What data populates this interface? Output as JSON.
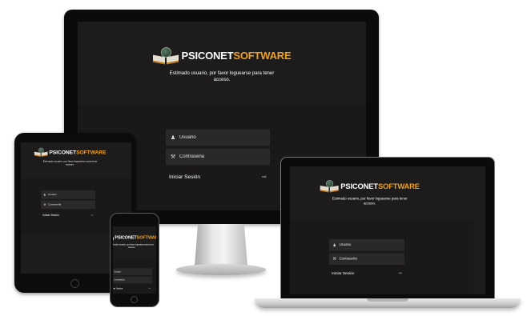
{
  "brand": {
    "name_part1": "PSICONET",
    "name_part2": "SOFTWARE",
    "accent_color": "#f0a21c",
    "logo_icon": "globe-book-icon"
  },
  "login": {
    "message": "Estimado usuario, por favor loguearse para tener acceso.",
    "username_placeholder": "Usuario",
    "password_placeholder": "Contraseña",
    "submit_label": "Iniciar Sesión",
    "user_icon": "user-icon",
    "password_icon": "key-icon",
    "submit_icon": "sign-in-icon"
  }
}
